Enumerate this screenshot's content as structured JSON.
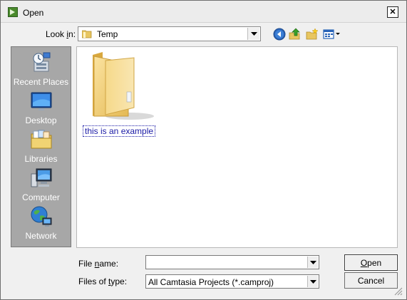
{
  "window": {
    "title": "Open",
    "close_glyph": "✕",
    "app_icon": "camtasia-icon"
  },
  "lookin": {
    "label_pre": "Look ",
    "label_accel": "i",
    "label_post": "n:",
    "value": "Temp"
  },
  "toolbar": {
    "icons": [
      "back-icon",
      "up-folder-icon",
      "new-folder-icon",
      "views-menu-icon"
    ]
  },
  "places": [
    {
      "label": "Recent Places",
      "icon": "recent-places-icon"
    },
    {
      "label": "Desktop",
      "icon": "desktop-icon"
    },
    {
      "label": "Libraries",
      "icon": "libraries-icon"
    },
    {
      "label": "Computer",
      "icon": "computer-icon"
    },
    {
      "label": "Network",
      "icon": "network-icon"
    }
  ],
  "files": [
    {
      "name": "this is an example",
      "type": "folder"
    }
  ],
  "filename": {
    "label_pre": "File ",
    "label_accel": "n",
    "label_post": "ame:",
    "value": ""
  },
  "filetype": {
    "label_pre": "Files of ",
    "label_accel": "t",
    "label_post": "ype:",
    "value": "All Camtasia Projects (*.camproj)"
  },
  "buttons": {
    "open_accel": "O",
    "open_rest": "pen",
    "cancel": "Cancel"
  },
  "colors": {
    "places_bg": "#a7a7a7",
    "selection_text": "#1a1aa6",
    "dialog_bg": "#f0f0f0"
  }
}
